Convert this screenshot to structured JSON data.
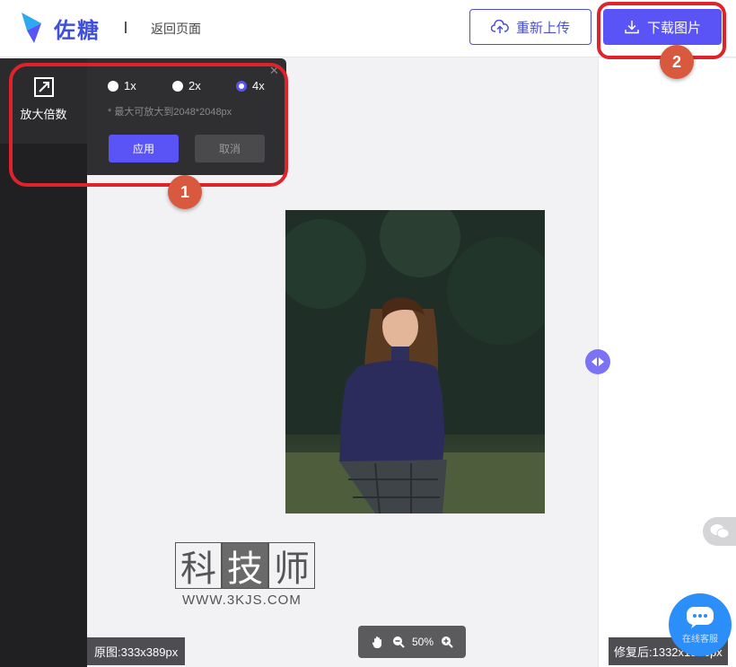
{
  "header": {
    "logo_text": "佐糖",
    "back_label": "返回页面",
    "reupload_label": "重新上传",
    "download_label": "下载图片"
  },
  "sidebar": {
    "tool_label": "放大倍数"
  },
  "scale_popup": {
    "options": [
      "1x",
      "2x",
      "4x"
    ],
    "selected": "4x",
    "hint": "* 最大可放大到2048*2048px",
    "apply_label": "应用",
    "cancel_label": "取消"
  },
  "annotations": {
    "step1": "1",
    "step2": "2"
  },
  "watermark": {
    "chars": [
      "科",
      "技",
      "师"
    ],
    "url": "WWW.3KJS.COM"
  },
  "zoom": {
    "level": "50%"
  },
  "sizes": {
    "original": "原图:333x389px",
    "fixed": "修复后:1332x1556px"
  },
  "floating": {
    "service_label": "在线客服"
  },
  "colors": {
    "accent": "#5a53f5",
    "annotation_red": "#e0232b",
    "badge": "#d9593f"
  }
}
